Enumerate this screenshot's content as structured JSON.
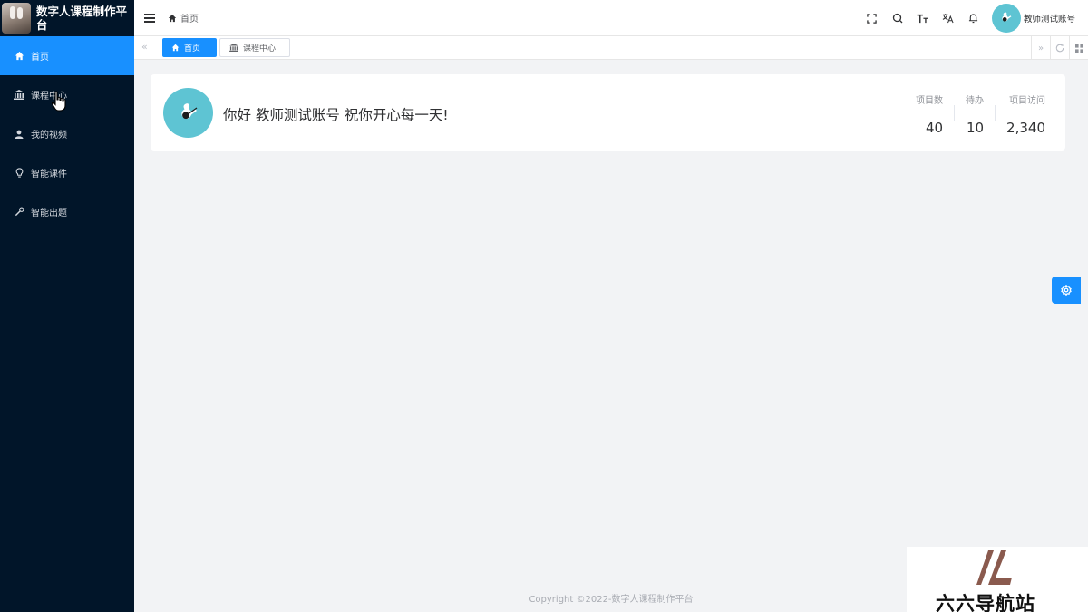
{
  "app": {
    "title": "数字人课程制作平台"
  },
  "sidebar": {
    "items": [
      {
        "label": "首页",
        "icon": "home-icon",
        "active": true
      },
      {
        "label": "课程中心",
        "icon": "bank-icon",
        "active": false
      },
      {
        "label": "我的视频",
        "icon": "user-icon",
        "active": false
      },
      {
        "label": "智能课件",
        "icon": "bulb-icon",
        "active": false
      },
      {
        "label": "智能出题",
        "icon": "wrench-icon",
        "active": false
      }
    ]
  },
  "header": {
    "breadcrumb": "首页",
    "username": "教师测试账号",
    "tools": [
      "fullscreen-icon",
      "search-icon",
      "font-size-icon",
      "translate-icon",
      "bell-icon"
    ]
  },
  "tabs": [
    {
      "label": "首页",
      "icon": "home-icon",
      "active": true
    },
    {
      "label": "课程中心",
      "icon": "bank-icon",
      "active": false
    }
  ],
  "welcome": {
    "greeting": "你好 教师测试账号 祝你开心每一天!",
    "stats": [
      {
        "label": "项目数",
        "value": "40"
      },
      {
        "label": "待办",
        "value": "10"
      },
      {
        "label": "项目访问",
        "value": "2,340"
      }
    ]
  },
  "footer": {
    "copyright": "Copyright ©2022-数字人课程制作平台"
  },
  "watermark": {
    "text": "六六导航站"
  },
  "colors": {
    "sidebar_bg": "#011529",
    "accent": "#1890ff",
    "avatar_bg": "#5ec4d3",
    "page_bg": "#f2f3f5"
  }
}
